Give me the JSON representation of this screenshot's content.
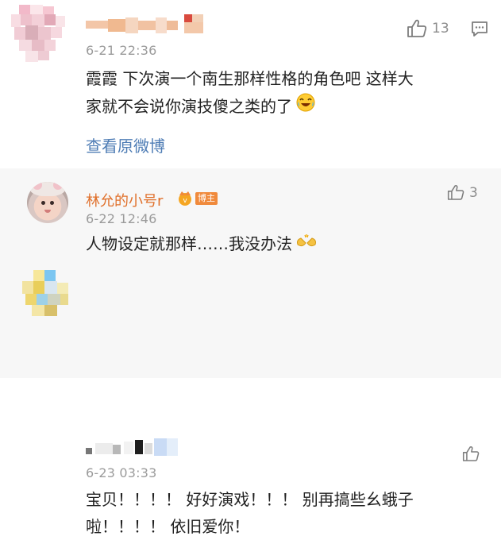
{
  "main_comment": {
    "timestamp": "6-21 22:36",
    "text_line1": "霞霞  下次演一个南生那样性格的角色吧  这样大",
    "text_line2": "家就不会说你演技傻之类的了",
    "emoji_name": "laughing-crying-emoji",
    "view_original_label": "查看原微博",
    "like_count": "13"
  },
  "replies": [
    {
      "username": "林允的小号r",
      "badge": "博主",
      "timestamp": "6-22 12:46",
      "text": "人物设定就那样……我没办法",
      "emoji_name": "clap-emoji",
      "like_count": "3"
    },
    {
      "timestamp": "6-23 03:33",
      "text_line1": "宝贝！！！！ 好好演戏！！！ 别再搞些幺蛾子",
      "text_line2": "啦！！！！ 依旧爱你！",
      "like_count": ""
    }
  ],
  "colors": {
    "username": "#e0702b",
    "link": "#4f7db5",
    "timestamp": "#9b9b9b",
    "reply_background": "#f7f7f7",
    "badge": "#f08a3c"
  }
}
